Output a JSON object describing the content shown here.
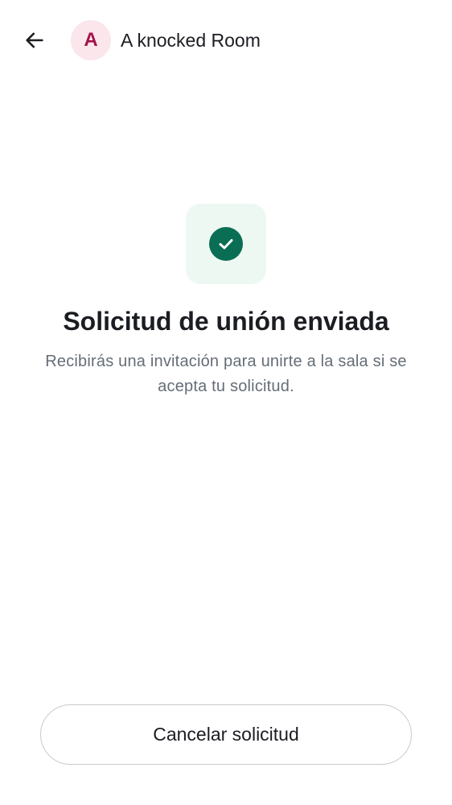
{
  "header": {
    "back_icon": "arrow-left-icon",
    "avatar_initial": "A",
    "room_name": "A knocked Room"
  },
  "status": {
    "icon": "check-circle-icon",
    "title": "Solicitud de unión enviada",
    "description": "Recibirás una invitación para unirte a la sala si se acepta tu solicitud."
  },
  "actions": {
    "cancel_label": "Cancelar solicitud"
  },
  "colors": {
    "avatar_bg": "#fbe6ec",
    "avatar_fg": "#a3134a",
    "success_tile_bg": "#eef8f3",
    "success_icon": "#0a6e54",
    "secondary_text": "#656d77",
    "button_border": "#c7cbd0"
  }
}
